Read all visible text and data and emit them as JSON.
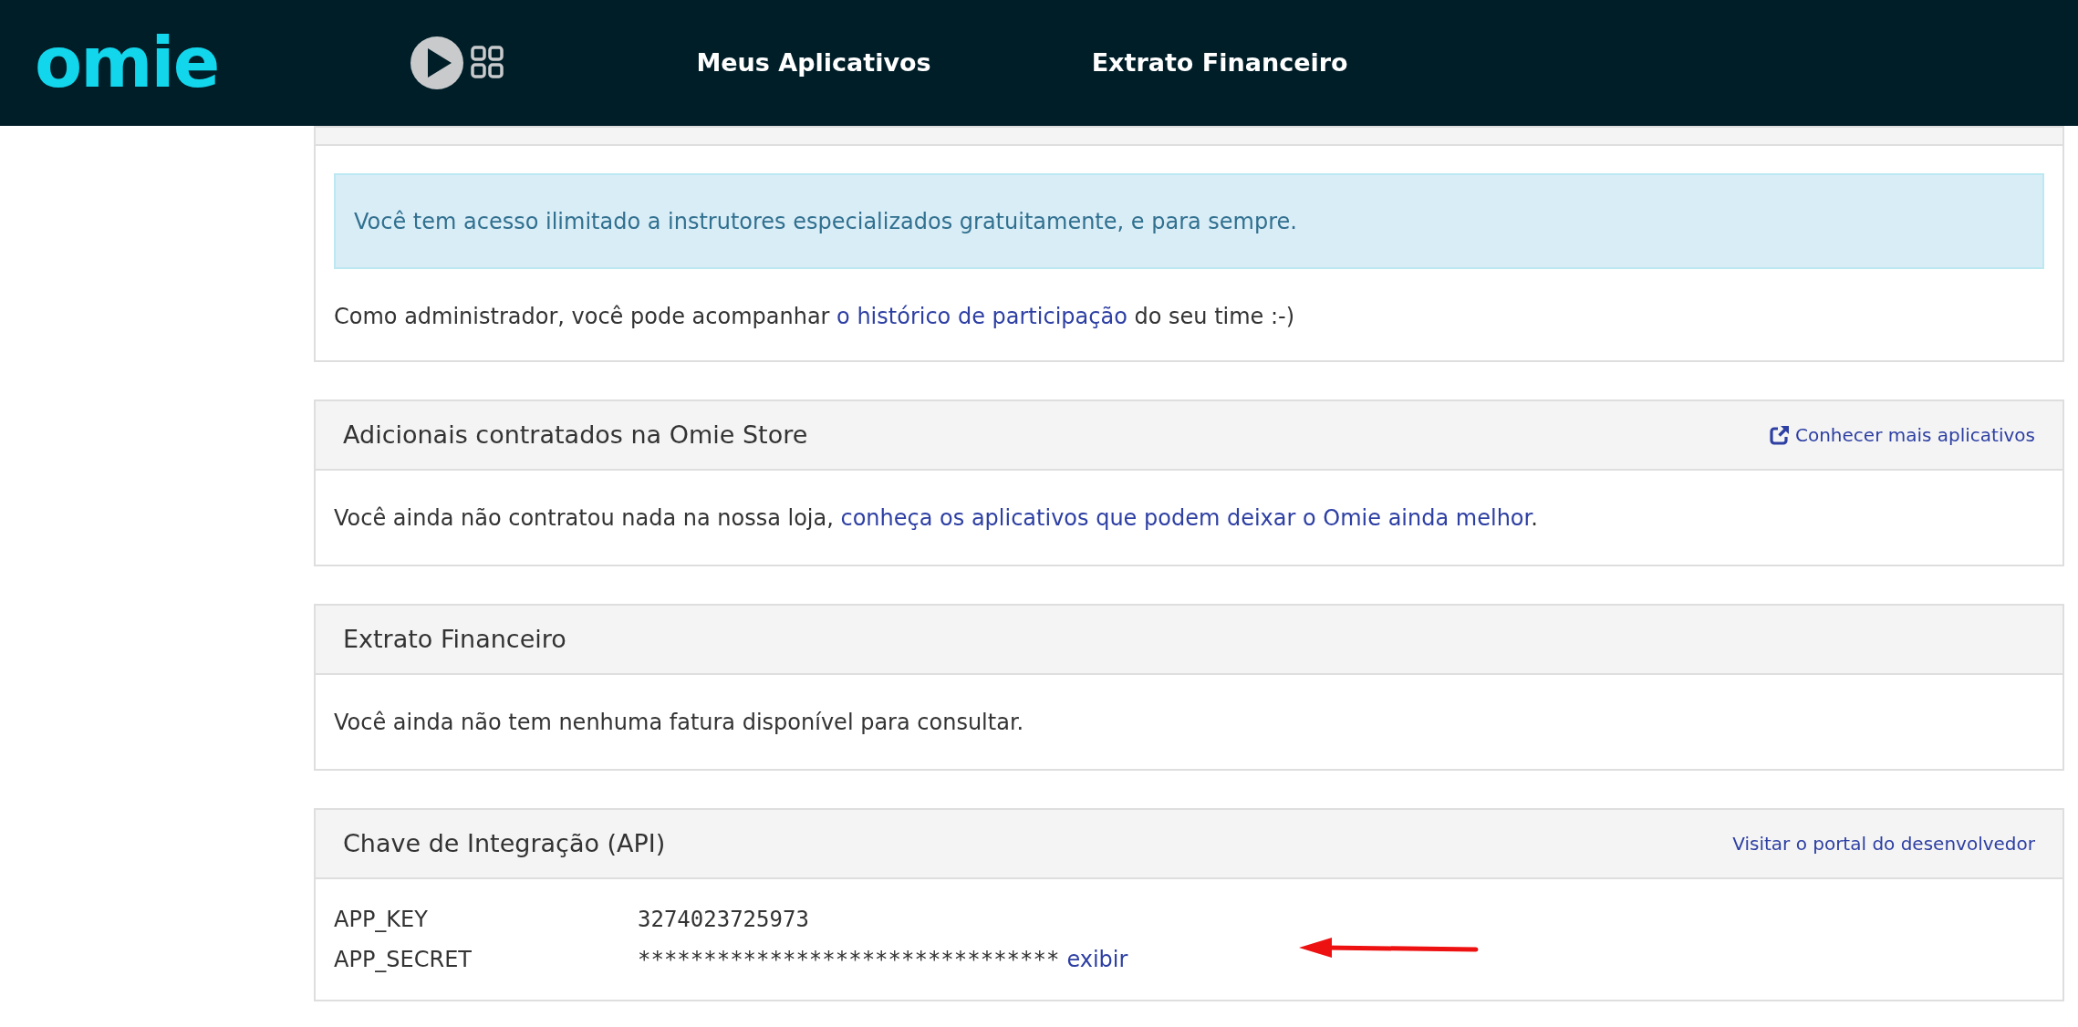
{
  "header": {
    "logo": "omie",
    "nav": [
      {
        "label": "Meus Aplicativos"
      },
      {
        "label": "Extrato Financeiro"
      }
    ]
  },
  "instructors_card": {
    "alert": "Você tem acesso ilimitado a instrutores especializados gratuitamente, e para sempre.",
    "text": [
      "Como administrador, você pode acompanhar ",
      "o histórico de participação",
      " do seu time :-)"
    ]
  },
  "store_card": {
    "title": "Adicionais contratados na Omie Store",
    "link": "Conhecer mais aplicativos",
    "text": [
      "Você ainda não contratou nada na nossa loja, ",
      "conheça os aplicativos que podem deixar o Omie ainda melhor",
      "."
    ]
  },
  "statement_card": {
    "title": "Extrato Financeiro",
    "text": "Você ainda não tem nenhuma fatura disponível para consultar."
  },
  "api_card": {
    "title": "Chave de Integração (API)",
    "link": "Visitar o portal do desenvolvedor",
    "rows": [
      {
        "label": "APP_KEY",
        "value": "3274023725973"
      },
      {
        "label": "APP_SECRET",
        "value": "********************************",
        "action": "exibir"
      }
    ]
  }
}
